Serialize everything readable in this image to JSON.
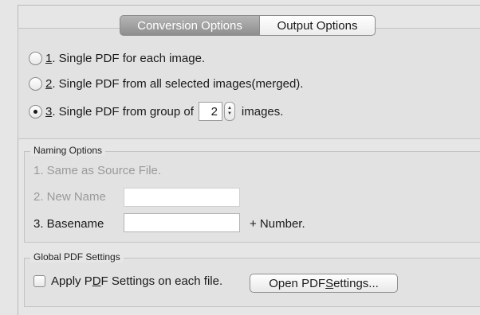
{
  "tabs": {
    "conversion": "Conversion Options",
    "output": "Output Options"
  },
  "conversion": {
    "option1": {
      "num": "1",
      "text": ". Single PDF for each image.",
      "selected": false
    },
    "option2": {
      "num": "2",
      "text": ". Single PDF from all selected images(merged).",
      "selected": false
    },
    "option3": {
      "num": "3",
      "text_before": ". Single PDF from group of",
      "group_value": "2",
      "text_after": "images.",
      "selected": true
    }
  },
  "naming": {
    "legend": "Naming Options",
    "opt1": "1. Same as Source File.",
    "opt2": "2. New Name",
    "opt2_value": "",
    "opt3": "3. Basename",
    "opt3_value": "",
    "suffix": "+ Number."
  },
  "global": {
    "legend": "Global PDF Settings",
    "checkbox_pre": "Apply P",
    "checkbox_key": "D",
    "checkbox_post": "F Settings on each file.",
    "checked": false,
    "button_pre": "Open PDF ",
    "button_key": "S",
    "button_post": "ettings..."
  },
  "colors": {
    "active_tab_text": "#ffffff",
    "disabled_text": "#9a9a9a"
  }
}
